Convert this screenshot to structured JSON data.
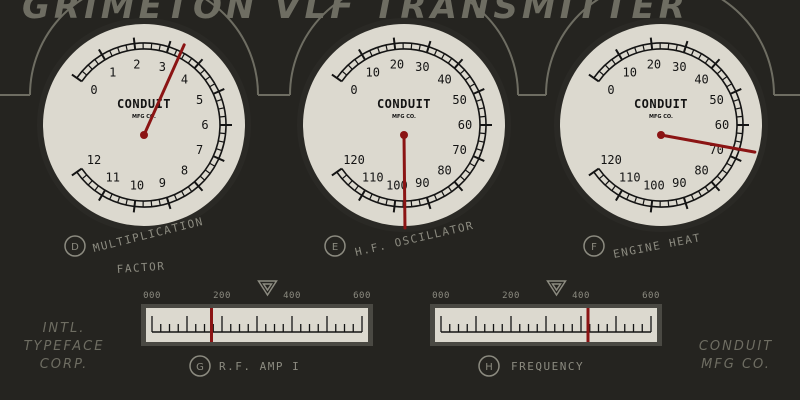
{
  "title": "GRIMETON VLF TRANSMITTER",
  "colors": {
    "background": "#252420",
    "dial_face": "#dcd9cf",
    "dial_bezel": "#2a2925",
    "ink": "#141414",
    "needle": "#8b1414",
    "label": "#8c8b80"
  },
  "gauges": [
    {
      "id": "D",
      "badge": "D",
      "label_line1": "MULTIPLICATION",
      "label_line2": "FACTOR",
      "brand": "CONDUIT",
      "brand_sub": "MFG CO.",
      "scale_labels": [
        "0",
        "1",
        "2",
        "3",
        "4",
        "5",
        "6",
        "7",
        "8",
        "9",
        "10",
        "11",
        "12"
      ],
      "min": 0,
      "max": 12,
      "value": 3.3
    },
    {
      "id": "E",
      "badge": "E",
      "label_line1": "H.F. OSCILLATOR",
      "label_line2": "",
      "brand": "CONDUIT",
      "brand_sub": "MFG CO.",
      "scale_labels": [
        "0",
        "10",
        "20",
        "30",
        "40",
        "50",
        "60",
        "70",
        "80",
        "90",
        "100",
        "110",
        "120"
      ],
      "min": 0,
      "max": 120,
      "value": 97
    },
    {
      "id": "F",
      "badge": "F",
      "label_line1": "ENGINE HEAT",
      "label_line2": "",
      "brand": "CONDUIT",
      "brand_sub": "MFG CO.",
      "scale_labels": [
        "0",
        "10",
        "20",
        "30",
        "40",
        "50",
        "60",
        "70",
        "80",
        "90",
        "100",
        "110",
        "120"
      ],
      "min": 0,
      "max": 120,
      "value": 65
    }
  ],
  "meters": [
    {
      "id": "G",
      "badge": "G",
      "label": "R.F. AMP I",
      "scale_labels": [
        "000",
        "200",
        "400",
        "600"
      ],
      "min": 0,
      "max": 600,
      "value": 170,
      "marker_value": 330
    },
    {
      "id": "H",
      "badge": "H",
      "label": "FREQUENCY",
      "scale_labels": [
        "000",
        "200",
        "400",
        "600"
      ],
      "min": 0,
      "max": 600,
      "value": 420,
      "marker_value": 330
    }
  ],
  "corner_left": [
    "INTL.",
    "TYPEFACE",
    "CORP."
  ],
  "corner_right": [
    "CONDUIT",
    "MFG CO."
  ]
}
